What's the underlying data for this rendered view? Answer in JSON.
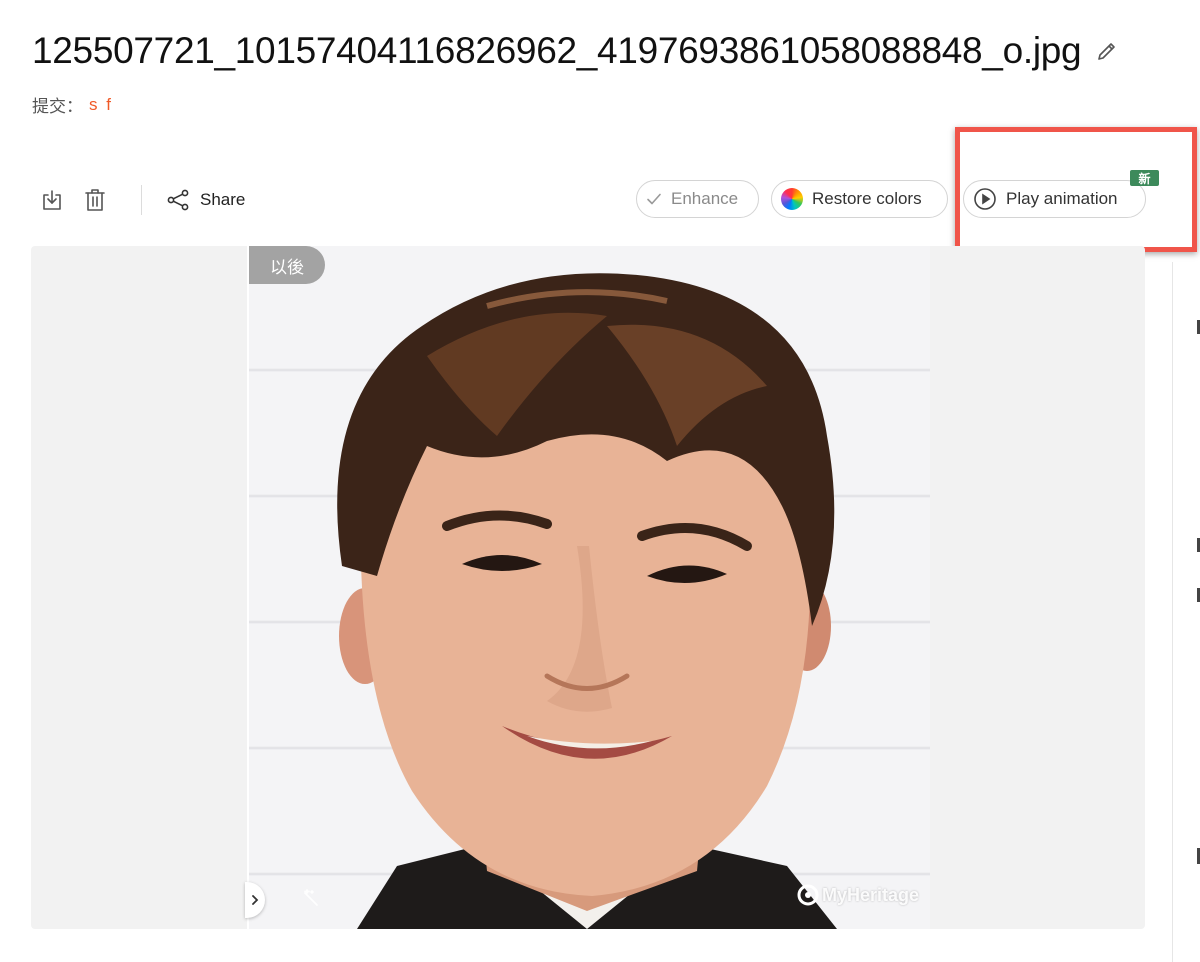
{
  "header": {
    "file_title": "125507721_10157404116826962_4197693861058088848_o.jpg",
    "submitted_label": "提交：",
    "submitter_name": "s f"
  },
  "toolbar": {
    "share_label": "Share",
    "enhance_label": "Enhance",
    "restore_colors_label": "Restore colors",
    "play_animation_label": "Play animation",
    "new_badge": "新"
  },
  "viewer": {
    "after_label": "以後",
    "watermark": "MyHeritage"
  },
  "colors": {
    "accent": "#f05a28",
    "highlight": "#f0554a",
    "badge": "#3d8a5b"
  },
  "icons": [
    "edit-icon",
    "download-icon",
    "trash-icon",
    "share-icon",
    "check-icon",
    "color-wheel-icon",
    "play-circle-icon",
    "chevron-right-icon",
    "magic-wand-icon",
    "myheritage-logo-icon"
  ]
}
